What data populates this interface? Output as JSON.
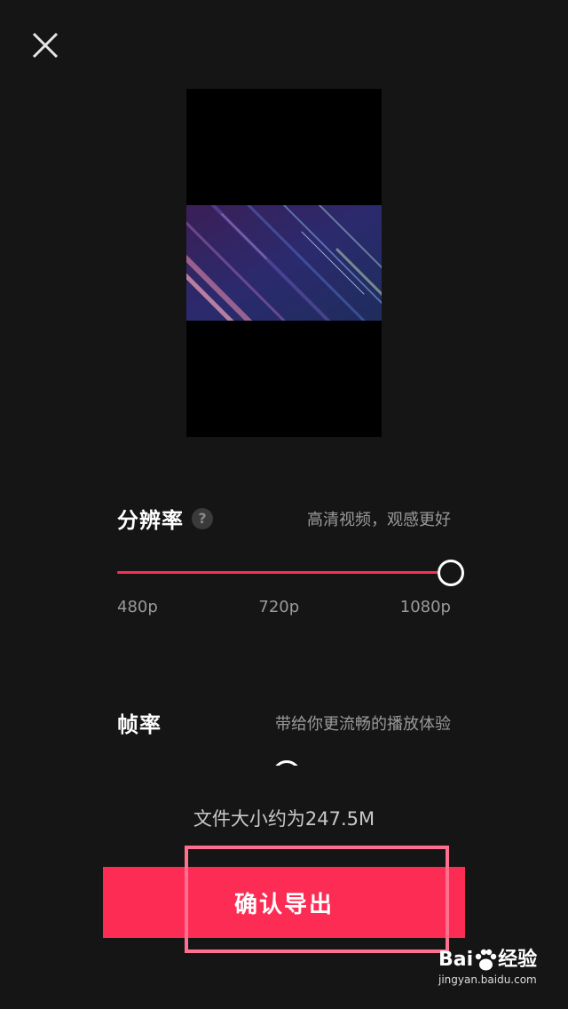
{
  "header": {
    "close_icon": "close-icon"
  },
  "preview": {
    "description_icon": "video-preview"
  },
  "resolution": {
    "title": "分辨率",
    "help_label": "?",
    "description": "高清视频，观感更好",
    "options": [
      "480p",
      "720p",
      "1080p"
    ],
    "selected": "1080p",
    "selected_fraction": 1.0
  },
  "frame_rate": {
    "title": "帧率",
    "description": "带给你更流畅的播放体验"
  },
  "file_size": "文件大小约为247.5M",
  "export_button": "确认导出",
  "colors": {
    "accent": "#fd2c55",
    "background": "#151515",
    "highlight": "#ff6f8f"
  },
  "watermark": {
    "logo": "Bai du 经验",
    "url": "jingyan.baidu.com"
  }
}
